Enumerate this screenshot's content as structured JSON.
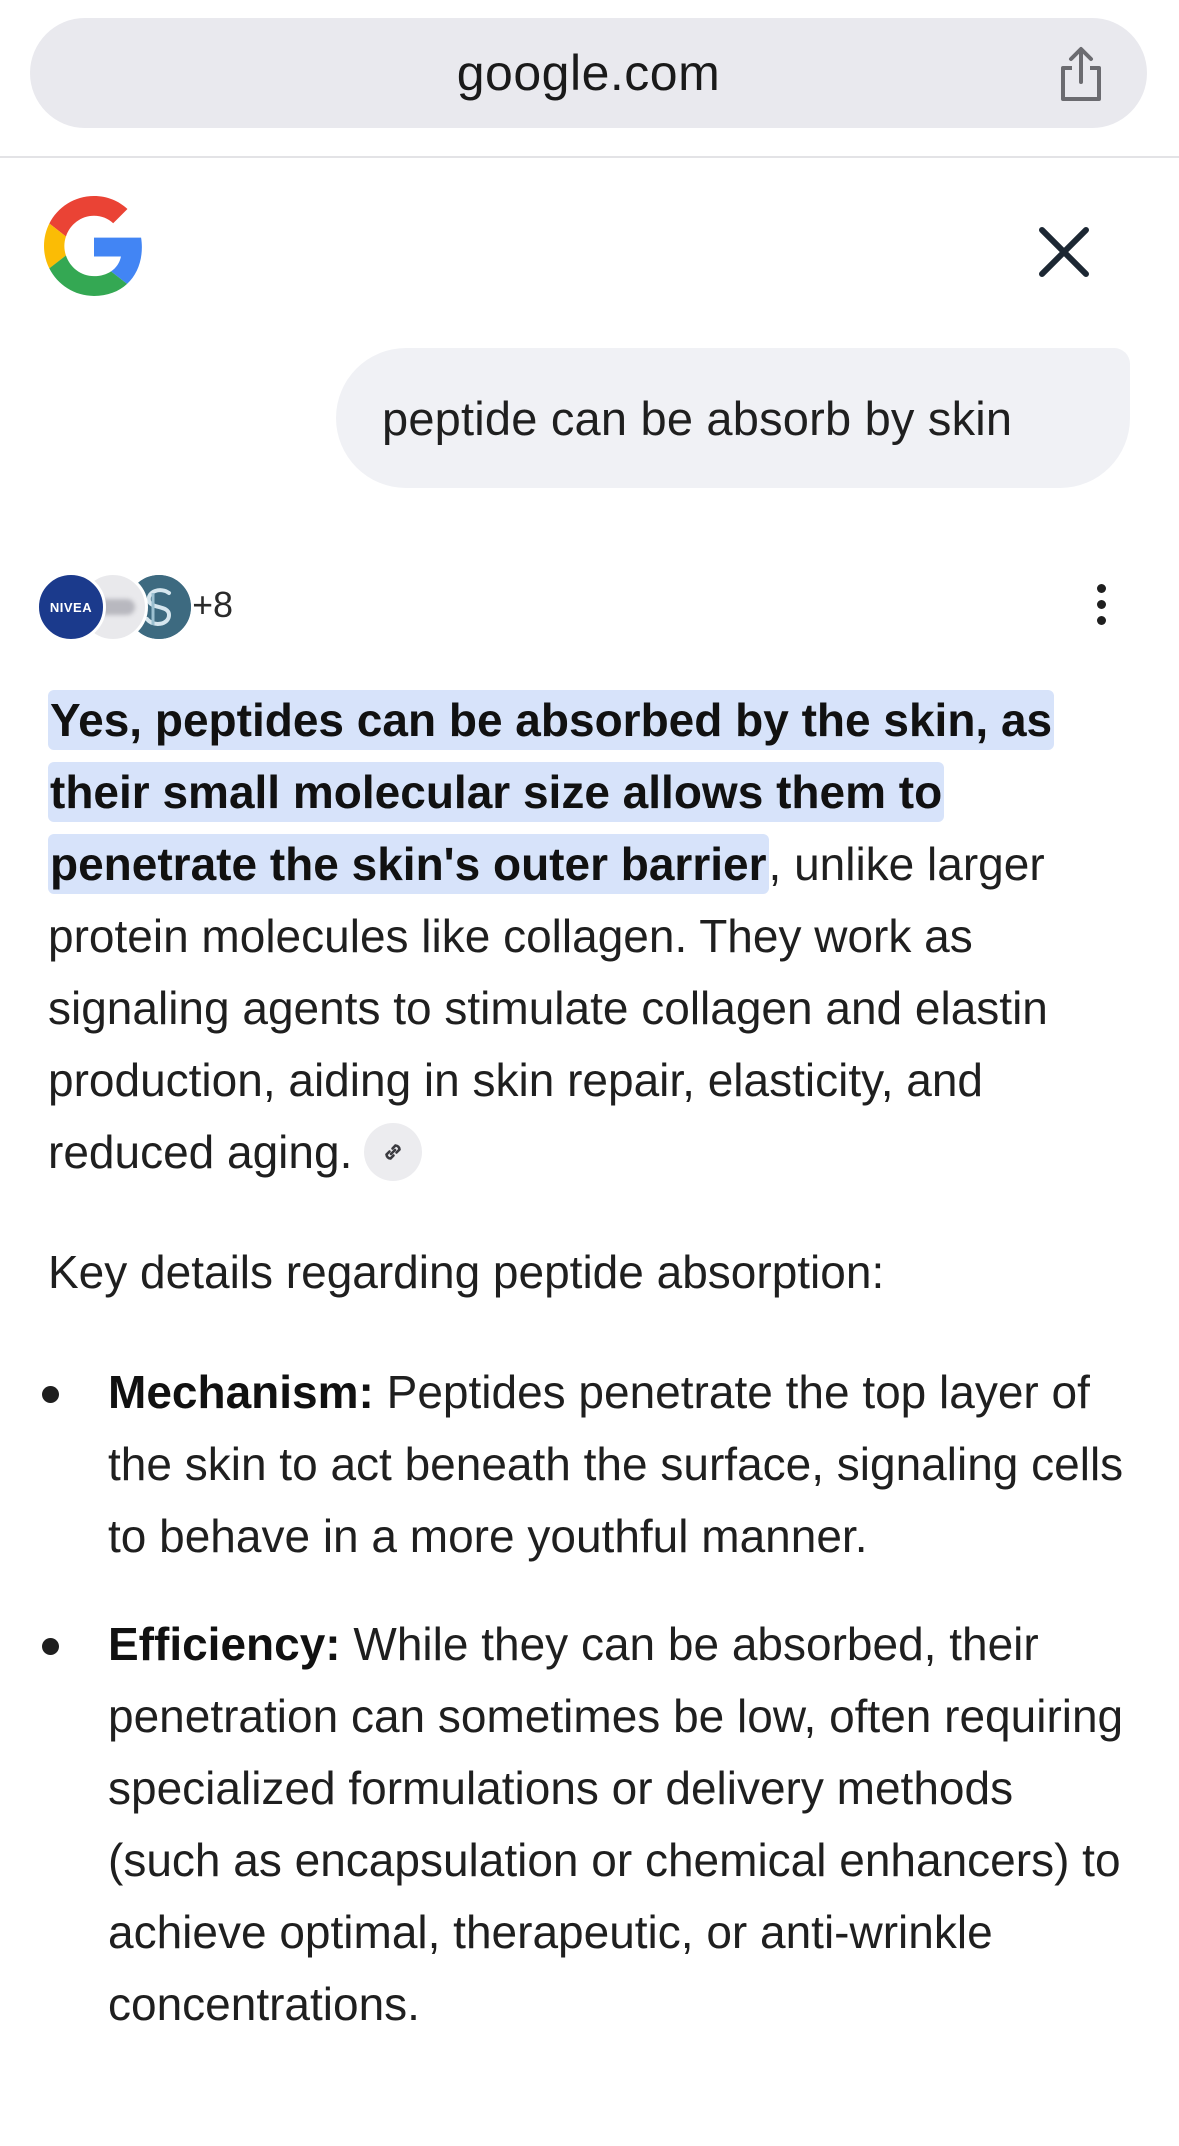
{
  "browser": {
    "url": "google.com",
    "share_icon": "share-icon"
  },
  "header": {
    "logo": "google-g-logo",
    "close_icon": "close-icon"
  },
  "query": {
    "text": "peptide can be absorb by skin"
  },
  "sources": {
    "items": [
      {
        "name": "NIVEA",
        "color": "#1b3a8c"
      },
      {
        "name": "",
        "color": "#e9e9ec"
      },
      {
        "name": "",
        "color": "#3d6a80"
      }
    ],
    "more_count": "+8",
    "menu_icon": "more-vert-icon"
  },
  "answer": {
    "highlighted": "Yes, peptides can be absorbed by the skin, as their small molecular size allows them to penetrate the skin's outer barrier",
    "rest": ", unlike larger protein molecules like collagen. They work as signaling agents to stimulate collagen and elastin production, aiding in skin repair, elasticity, and reduced aging.",
    "link_icon": "link-icon",
    "highlight_color": "#d7e3fa"
  },
  "key_details": {
    "heading": "Key details regarding peptide absorption:",
    "items": [
      {
        "title": "Mechanism:",
        "text": " Peptides penetrate the top layer of the skin to act beneath the surface, signaling cells to behave in a more youthful manner."
      },
      {
        "title": "Efficiency:",
        "text": " While they can be absorbed, their penetration can sometimes be low, often requiring specialized formulations or delivery methods (such as encapsulation or chemical enhancers) to achieve optimal, therapeutic, or anti-wrinkle concentrations."
      }
    ]
  }
}
